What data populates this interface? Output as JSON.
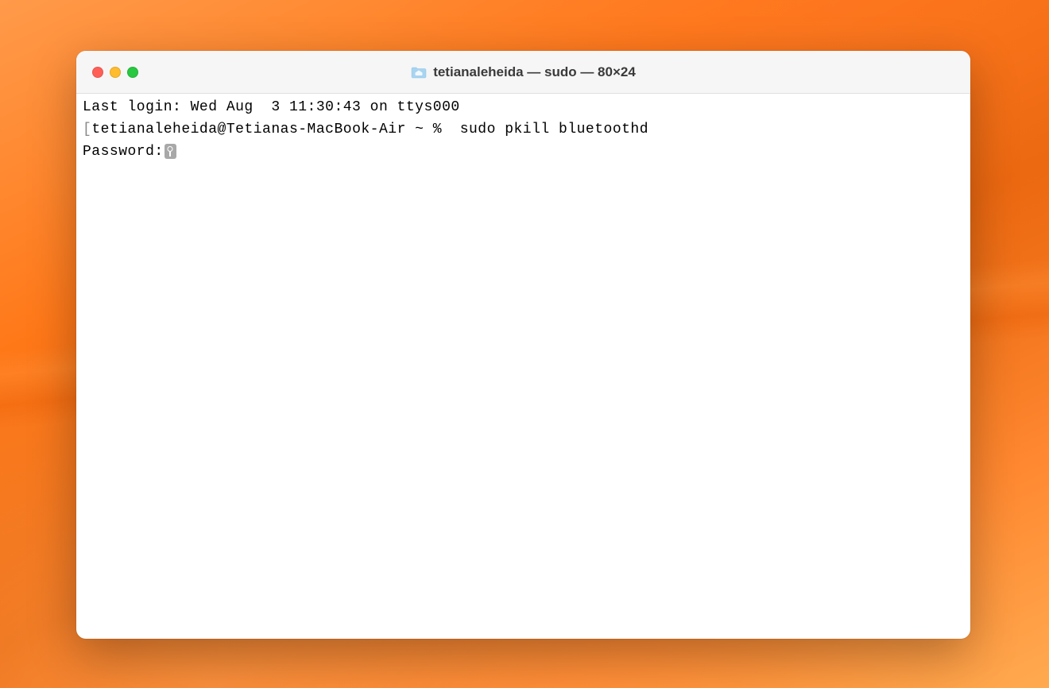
{
  "window": {
    "title": "tetianaleheida — sudo — 80×24"
  },
  "terminal": {
    "line1": "Last login: Wed Aug  3 11:30:43 on ttys000",
    "line2_prompt": "tetianaleheida@Tetianas-MacBook-Air ~ % ",
    "line2_command": " sudo pkill bluetoothd",
    "line3_label": "Password:"
  }
}
